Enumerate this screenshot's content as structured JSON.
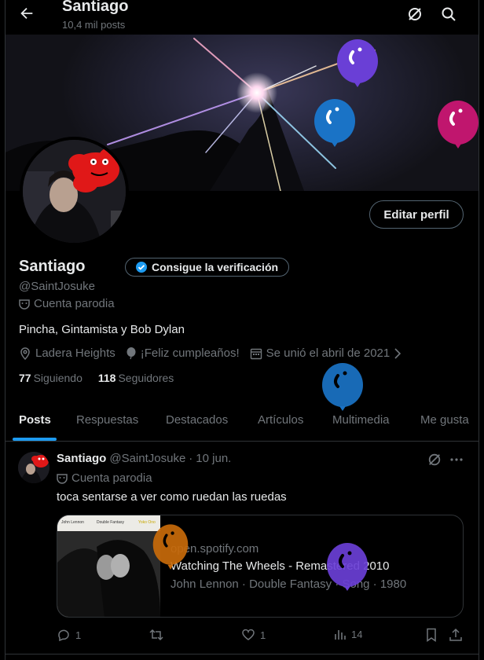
{
  "header": {
    "title": "Santiago",
    "post_count": "10,4 mil posts",
    "icons": [
      "arrow-left-icon",
      "grok-icon",
      "search-icon"
    ]
  },
  "profile": {
    "display_name": "Santiago",
    "handle": "@SaintJosuke",
    "verify_label": "Consigue la verificación",
    "parody_label": "Cuenta parodia",
    "bio": "Pincha, Gintamista y Bob Dylan",
    "location": "Ladera Heights",
    "birthday": "¡Feliz cumpleaños!",
    "joined": "Se unió el abril de 2021",
    "following_count": "77",
    "following_label": "Siguiendo",
    "followers_count": "118",
    "followers_label": "Seguidores",
    "edit_button": "Editar perfil"
  },
  "tabs": [
    {
      "label": "Posts",
      "active": true
    },
    {
      "label": "Respuestas",
      "active": false
    },
    {
      "label": "Destacados",
      "active": false
    },
    {
      "label": "Artículos",
      "active": false
    },
    {
      "label": "Multimedia",
      "active": false
    },
    {
      "label": "Me gusta",
      "active": false
    }
  ],
  "post": {
    "author_name": "Santiago",
    "author_handle": "@SaintJosuke",
    "separator": "·",
    "date": "10 jun.",
    "parody_label": "Cuenta parodia",
    "text": "toca sentarse a ver como ruedan las ruedas",
    "card": {
      "album_artist": "John Lennon",
      "album_title": "Double Fantasy",
      "album_credit": "Yoko Ono",
      "domain": "open.spotify.com",
      "title": "Watching The Wheels - Remastered 2010",
      "subtitle": "John Lennon · Double Fantasy · Song · 1980"
    },
    "stats": {
      "replies": "1",
      "retweets": "",
      "likes": "1",
      "views": "14"
    }
  },
  "colors": {
    "background": "#000000",
    "text": "#e7e9ea",
    "muted": "#71767b",
    "accent": "#1d9bf0",
    "border": "#2f3336",
    "balloon_purple": "#6a3fd6",
    "balloon_blue": "#1a73c6",
    "balloon_pink": "#c0166e",
    "balloon_orange": "#c86a0a"
  }
}
